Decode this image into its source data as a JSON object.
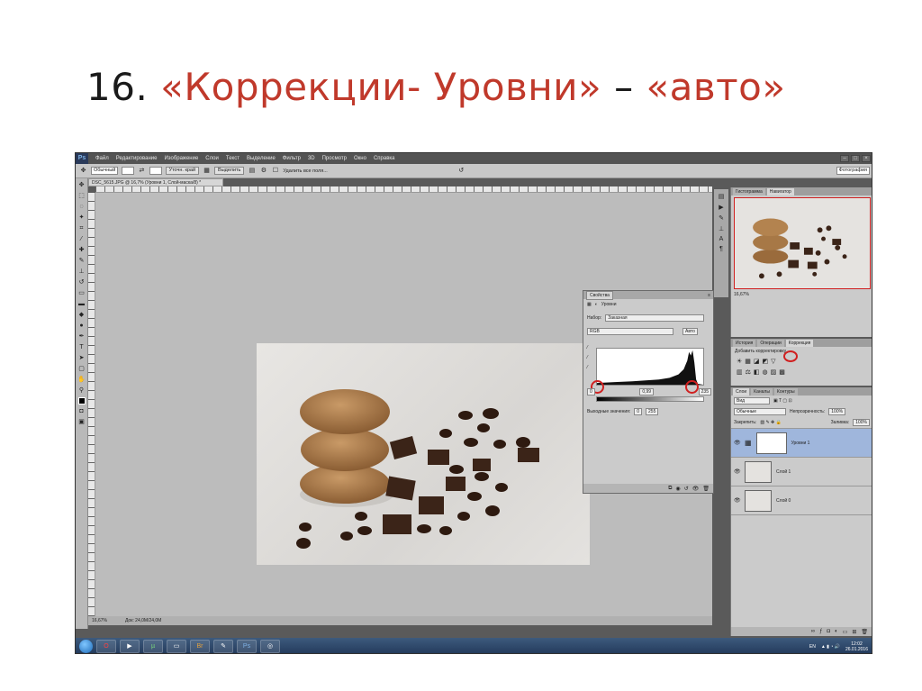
{
  "slide": {
    "number": "16.",
    "title_part1": "«Коррекции- Уровни»",
    "dash": "–",
    "title_part2": "«авто»"
  },
  "menu": {
    "logo": "Ps",
    "items": [
      "Файл",
      "Редактирование",
      "Изображение",
      "Слои",
      "Текст",
      "Выделение",
      "Фильтр",
      "3D",
      "Просмотр",
      "Окно",
      "Справка"
    ]
  },
  "options": {
    "style_select": "Обычный",
    "refine_button": "Уточн. край",
    "refine2_button": "Выделить",
    "remove_chk": "Удалить все поля...",
    "workspace_select": "Фотография"
  },
  "document": {
    "tab_label": "DSC_5615.JPG @ 16,7% (Уровни 1, Слой-маска/8) *",
    "zoom": "16,67%",
    "doc_info": "Док: 24,0M/24,0M"
  },
  "properties": {
    "tab_label": "Свойства",
    "title": "Уровни",
    "preset_label": "Набор:",
    "preset_value": "Заказная",
    "channel_value": "RGB",
    "auto_button": "Авто",
    "input_low": "0",
    "input_mid": "0,99",
    "input_high": "235",
    "output_label": "Выходные значения:",
    "output_low": "0",
    "output_high": "255"
  },
  "navigator": {
    "tabs": [
      "Гистограмма",
      "Навигатор"
    ],
    "zoom": "16,67%"
  },
  "adjustments": {
    "tabs": [
      "История",
      "Операции",
      "Коррекция"
    ],
    "add_label": "Добавить корректировку"
  },
  "layers": {
    "tabs": [
      "Слои",
      "Каналы",
      "Контуры"
    ],
    "kind_select": "Вид",
    "blend_select": "Обычные",
    "opacity_label": "Непрозрачность:",
    "opacity_value": "100%",
    "lock_label": "Закрепить:",
    "fill_label": "Заливка:",
    "fill_value": "100%",
    "items": [
      {
        "name": "Уровни 1",
        "selected": true
      },
      {
        "name": "Слой 1",
        "selected": false
      },
      {
        "name": "Слой 0",
        "selected": false
      }
    ]
  },
  "taskbar": {
    "lang": "EN",
    "time": "12:02",
    "date": "26.01.2016"
  }
}
